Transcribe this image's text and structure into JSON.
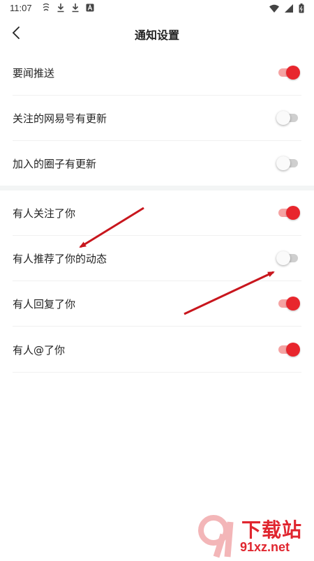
{
  "status_bar": {
    "time": "11:07",
    "left_icons": [
      "notification-app-icon",
      "download-icon",
      "download-icon",
      "app-a-icon"
    ],
    "right_icons": [
      "wifi-icon",
      "signal-icon",
      "battery-icon"
    ]
  },
  "header": {
    "title": "通知设置",
    "back_icon": "back-arrow-icon"
  },
  "settings": [
    {
      "label": "要闻推送",
      "enabled": true
    },
    {
      "label": "关注的网易号有更新",
      "enabled": false
    },
    {
      "label": "加入的圈子有更新",
      "enabled": false
    },
    {
      "label": "有人关注了你",
      "enabled": true
    },
    {
      "label": "有人推荐了你的动态",
      "enabled": false
    },
    {
      "label": "有人回复了你",
      "enabled": true
    },
    {
      "label": "有人@了你",
      "enabled": true
    }
  ],
  "colors": {
    "accent": "#e8262d",
    "toggle_on_track": "#f5a3a3",
    "toggle_off_track": "#cfcfcf",
    "annotation_arrow": "#c8161d",
    "section_divider": "#f3f5f5"
  },
  "watermark": {
    "brand": "下载站",
    "url": "91xz.net"
  }
}
